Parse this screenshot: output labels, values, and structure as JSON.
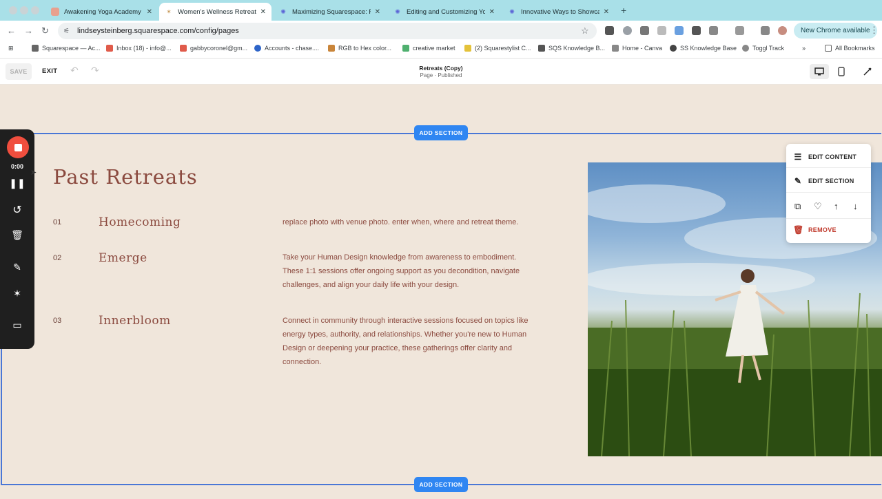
{
  "browser": {
    "tabs": [
      {
        "label": "Awakening Yoga Academy",
        "active": false,
        "icon": "yoga-favicon-icon"
      },
      {
        "label": "Women's Wellness Retreats -",
        "active": true,
        "icon": "squarespace-favicon-icon"
      },
      {
        "label": "Maximizing Squarespace: Re",
        "active": false,
        "icon": "gear-favicon-icon"
      },
      {
        "label": "Editing and Customizing Your",
        "active": false,
        "icon": "gear-favicon-icon"
      },
      {
        "label": "Innovative Ways to Showcase",
        "active": false,
        "icon": "gear-favicon-icon"
      }
    ],
    "url": "lindseysteinberg.squarespace.com/config/pages",
    "update_label": "New Chrome available",
    "bookmarks": [
      "Squarespace — Ac...",
      "Inbox (18) - info@...",
      "gabbycoronel@gm...",
      "Accounts - chase....",
      "RGB to Hex color...",
      "creative market",
      "(2) Squarestylist C...",
      "SQS Knowledge B...",
      "Home - Canva",
      "SS Knowledge Base",
      "Toggl Track"
    ],
    "all_bookmarks": "All Bookmarks"
  },
  "editor": {
    "save": "SAVE",
    "exit": "EXIT",
    "page_title": "Retreats (Copy)",
    "page_status": "Page · Published",
    "add_section": "ADD SECTION"
  },
  "content": {
    "heading": "Past Retreats",
    "retreats": [
      {
        "num": "01",
        "name": "Homecoming",
        "desc": "replace photo with venue photo. enter when, where and retreat theme."
      },
      {
        "num": "02",
        "name": "Emerge",
        "desc": "Take your Human Design knowledge from awareness to embodiment. These 1:1 sessions offer ongoing support as you decondition, navigate challenges, and align your daily life with your design."
      },
      {
        "num": "03",
        "name": "Innerbloom",
        "desc": "Connect in community through interactive sessions focused on topics like energy types, authority, and relationships. Whether you're new to Human Design or deepening your practice, these gatherings offer clarity and connection."
      }
    ]
  },
  "edit_panel": {
    "edit_content": "EDIT CONTENT",
    "edit_section": "EDIT SECTION",
    "remove": "REMOVE"
  },
  "recorder": {
    "time": "0:00"
  },
  "colors": {
    "accent_blue": "#2f86f2",
    "heading_brown": "#8b4a3f",
    "background": "#f0e6db",
    "record_red": "#f04e3e",
    "remove_red": "#c0392b"
  }
}
